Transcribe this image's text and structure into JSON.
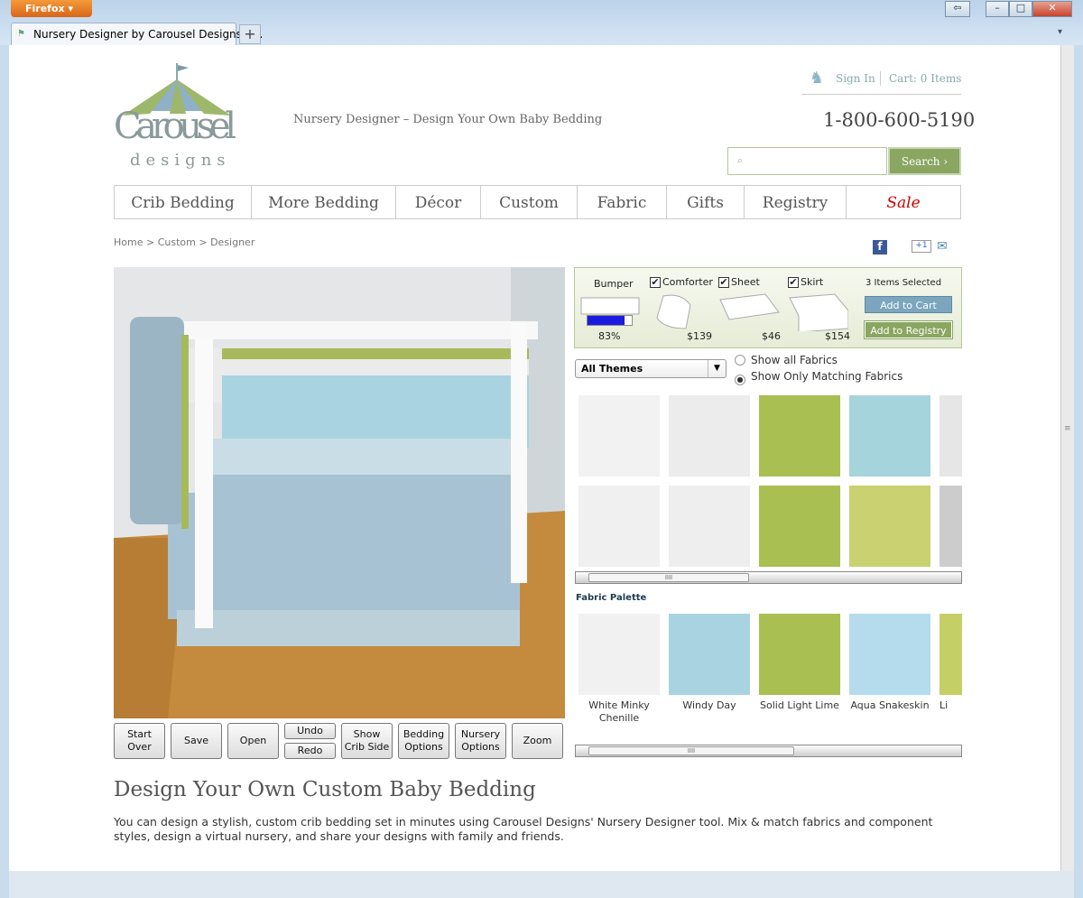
{
  "browser": {
    "menu_label": "Firefox",
    "tab_title": "Nursery Designer by Carousel Designs - ...",
    "new_tab": "+"
  },
  "header": {
    "logo_word": "Carousel",
    "logo_sub": "designs",
    "tagline": "Nursery Designer – Design Your Own Baby Bedding",
    "sign_in": "Sign In",
    "cart": "Cart: 0 Items",
    "phone": "1-800-600-5190",
    "search_placeholder": "",
    "search_button": "Search ›"
  },
  "nav": [
    "Crib Bedding",
    "More Bedding",
    "Décor",
    "Custom",
    "Fabric",
    "Gifts",
    "Registry",
    "Sale"
  ],
  "breadcrumb": {
    "home": "Home",
    "custom": "Custom",
    "current": "Designer",
    "sep": ">"
  },
  "components": {
    "items": [
      {
        "label": "Bumper",
        "checked": false,
        "price": "83%"
      },
      {
        "label": "Comforter",
        "checked": true,
        "price": "$139"
      },
      {
        "label": "Sheet",
        "checked": true,
        "price": "$46"
      },
      {
        "label": "Skirt",
        "checked": true,
        "price": "$154"
      }
    ],
    "bumper_progress": 0.83,
    "selected_count": "3 Items Selected",
    "add_to_cart": "Add to Cart",
    "add_to_registry": "Add to Registry"
  },
  "filters": {
    "theme": "All Themes",
    "show_all": "Show all Fabrics",
    "show_matching": "Show Only Matching Fabrics",
    "selected": "show_matching"
  },
  "fabric_grid": {
    "colors": [
      "#f2f2f2",
      "#ececec",
      "#a9bf52",
      "#a6d4dc",
      "#e6e6e6",
      "#f0f0f0",
      "#eeeeee",
      "#a9bf52",
      "#c9d170",
      "#cccccc"
    ]
  },
  "palette": {
    "title": "Fabric Palette",
    "items": [
      {
        "name": "White Minky Chenille",
        "color": "#f1f1f1"
      },
      {
        "name": "Windy Day",
        "color": "#a9d3e0"
      },
      {
        "name": "Solid Light Lime",
        "color": "#a9bf52"
      },
      {
        "name": "Aqua Snakeskin",
        "color": "#b5dcec"
      },
      {
        "name": "Li",
        "color": "#c4cf66"
      }
    ]
  },
  "toolbar": {
    "start_over": "Start Over",
    "save": "Save",
    "open": "Open",
    "undo": "Undo",
    "redo": "Redo",
    "show_crib_side": "Show Crib Side",
    "bedding_options": "Bedding Options",
    "nursery_options": "Nursery Options",
    "zoom": "Zoom"
  },
  "content": {
    "heading": "Design Your Own Custom Baby Bedding",
    "body": "You can design a stylish, custom crib bedding set in minutes using Carousel Designs' Nursery Designer tool. Mix & match fabrics and component styles, design a virtual nursery, and share your designs with family and friends."
  },
  "colors": {
    "accent_green": "#8aa661",
    "cart_blue": "#7ba6bd",
    "sale_red": "#cc0000",
    "panel_bg": "#eef2e2"
  }
}
